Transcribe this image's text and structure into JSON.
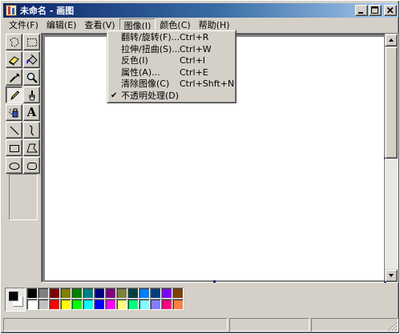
{
  "window": {
    "title": "未命名 - 画图"
  },
  "menubar": {
    "items": [
      {
        "id": "file",
        "label": "文件(F)"
      },
      {
        "id": "edit",
        "label": "编辑(E)"
      },
      {
        "id": "view",
        "label": "查看(V)"
      },
      {
        "id": "image",
        "label": "图像(I)"
      },
      {
        "id": "colors",
        "label": "颜色(C)"
      },
      {
        "id": "help",
        "label": "帮助(H)"
      }
    ],
    "active": "image"
  },
  "image_menu": {
    "items": [
      {
        "label": "翻转/旋转(F)...",
        "shortcut": "Ctrl+R"
      },
      {
        "label": "拉伸/扭曲(S)...",
        "shortcut": "Ctrl+W"
      },
      {
        "label": "反色(I)",
        "shortcut": "Ctrl+I"
      },
      {
        "label": "属性(A)...",
        "shortcut": "Ctrl+E"
      },
      {
        "label": "清除图像(C)",
        "shortcut": "Ctrl+Shft+N"
      },
      {
        "label": "不透明处理(D)",
        "shortcut": "",
        "checked": true
      }
    ],
    "check_mark": "✔"
  },
  "toolbox": {
    "tools": [
      "free-form-select",
      "rectangle-select",
      "eraser",
      "fill-with-color",
      "pick-color",
      "magnifier",
      "pencil",
      "brush",
      "airbrush",
      "text",
      "line",
      "curve",
      "rectangle",
      "polygon",
      "ellipse",
      "rounded-rectangle"
    ],
    "selected": "pencil",
    "text_tool_glyph": "A"
  },
  "palette": {
    "foreground": "#000000",
    "background": "#ffffff",
    "colors": [
      "#000000",
      "#808080",
      "#800000",
      "#808000",
      "#008000",
      "#008080",
      "#000080",
      "#800080",
      "#808040",
      "#004040",
      "#0080ff",
      "#004080",
      "#8000ff",
      "#804000",
      "#ffffff",
      "#c0c0c0",
      "#ff0000",
      "#ffff00",
      "#00ff00",
      "#00ffff",
      "#0000ff",
      "#ff00ff",
      "#ffff80",
      "#00ff80",
      "#80ffff",
      "#8080ff",
      "#ff0080",
      "#ff8040"
    ]
  }
}
